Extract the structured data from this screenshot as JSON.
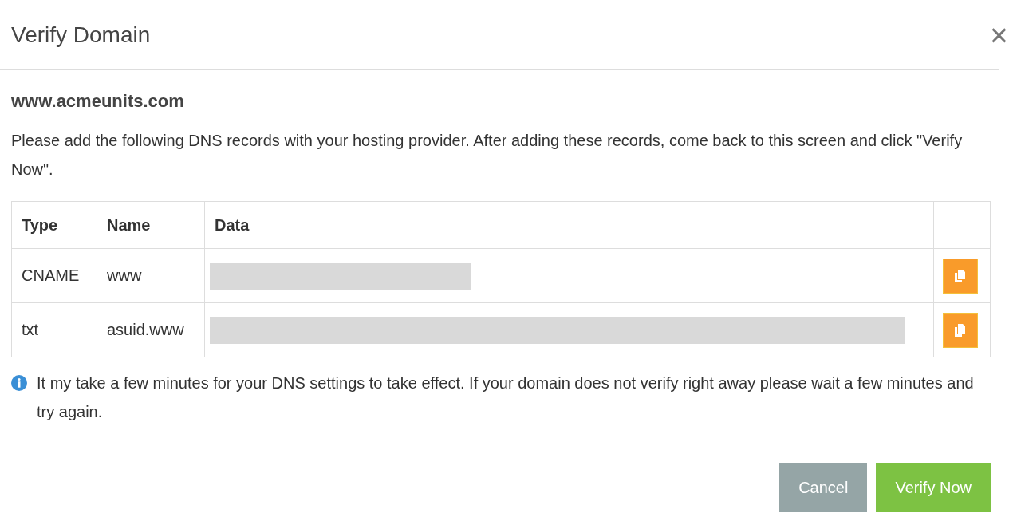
{
  "dialog": {
    "title": "Verify Domain",
    "close": "×"
  },
  "domain": "www.acmeunits.com",
  "instructions": "Please add the following DNS records with your hosting provider. After adding these records, come back to this screen and click \"Verify Now\".",
  "table": {
    "columns": [
      "Type",
      "Name",
      "Data"
    ],
    "rows": [
      {
        "type": "CNAME",
        "name": "www",
        "data": {
          "kind": "redacted"
        }
      },
      {
        "type": "txt",
        "name": "asuid.www",
        "data": {
          "kind": "redacted"
        }
      }
    ]
  },
  "note": "It my take a few minutes for your DNS settings to take effect. If your domain does not verify right away please wait a few minutes and try again.",
  "buttons": [
    {
      "label": "Cancel",
      "kind": "secondary"
    },
    {
      "label": "Verify Now",
      "kind": "primary"
    }
  ]
}
